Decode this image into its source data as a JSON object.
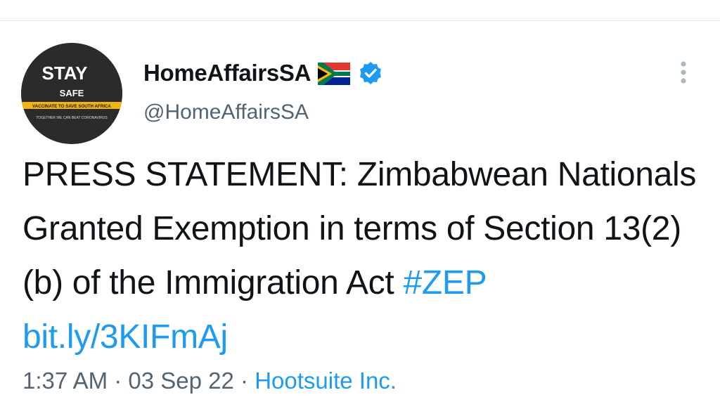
{
  "author": {
    "display_name": "HomeAffairsSA",
    "handle": "@HomeAffairsSA",
    "avatar_text": {
      "line1": "STAY",
      "line2": "SAFE",
      "line3": "VACCINATE TO SAVE SOUTH AFRICA",
      "line4": "TOGETHER WE CAN BEAT CORONAVIRUS"
    },
    "flag_icon": "south-africa-flag",
    "verified_icon": "verified-badge"
  },
  "tweet": {
    "text": "PRESS STATEMENT: Zimbabwean Nationals Granted Exemption in terms of Section 13(2)(b) of the Immigration Act ",
    "hashtag": "#ZEP",
    "link": "bit.ly/3KIFmAj"
  },
  "meta": {
    "time": "1:37 AM",
    "separator": " · ",
    "date": "03 Sep 22",
    "source": "Hootsuite Inc."
  },
  "colors": {
    "accent": "#1d9bf0",
    "muted": "#536471",
    "text": "#0f1419"
  }
}
